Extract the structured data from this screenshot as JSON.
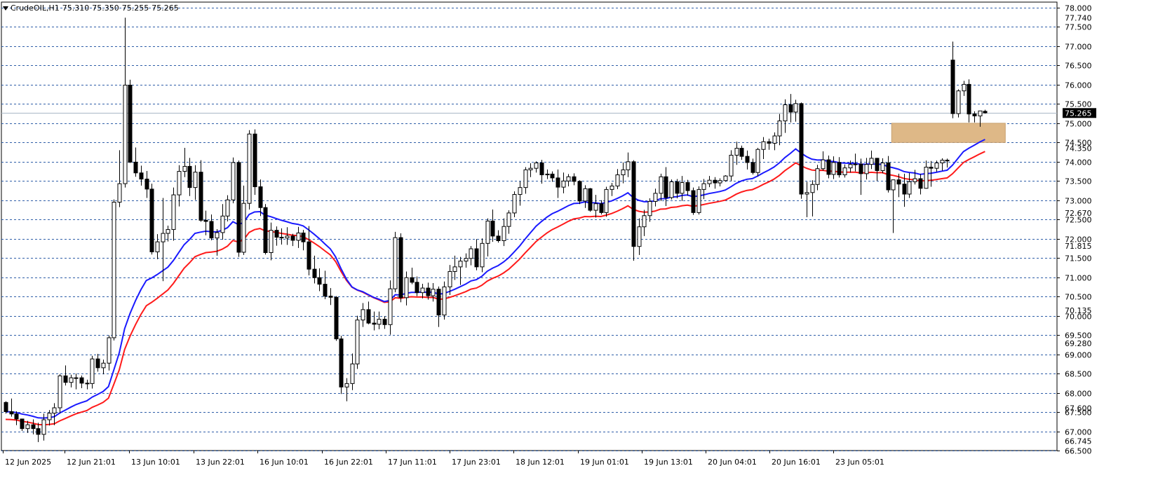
{
  "header": {
    "symbol_timeframe": "CrudeOIL,H1",
    "open": "75.310",
    "high": "75.350",
    "low": "75.255",
    "close": "75.265"
  },
  "colors": {
    "background": "#ffffff",
    "grid": "#2f5ea8",
    "bull_candle": "#ffffff",
    "bear_candle": "#000000",
    "ma_fast": "#1a1aff",
    "ma_slow": "#ff1a1a",
    "zone": "#deb887",
    "price_line": "#a9b7c6",
    "price_badge_bg": "#000000",
    "price_badge_fg": "#ffffff"
  },
  "chart_data": {
    "type": "candlestick",
    "symbol": "CrudeOIL",
    "timeframe": "H1",
    "y_range": [
      66.5,
      78.0
    ],
    "y_ticks": [
      "78.000",
      "77.500",
      "77.000",
      "76.500",
      "76.000",
      "75.500",
      "75.000",
      "74.500",
      "74.000",
      "73.500",
      "73.000",
      "72.500",
      "72.000",
      "71.500",
      "71.000",
      "70.500",
      "70.000",
      "69.500",
      "69.000",
      "68.500",
      "68.000",
      "67.500",
      "67.000",
      "66.500"
    ],
    "extra_price_labels": [
      "77.740",
      "74.350",
      "72.670",
      "71.815",
      "70.135",
      "69.280",
      "67.600",
      "66.745"
    ],
    "current_price": "75.265",
    "x_labels": [
      "12 Jun 2025",
      "12 Jun 21:01",
      "13 Jun 10:01",
      "13 Jun 22:01",
      "16 Jun 10:01",
      "16 Jun 22:01",
      "17 Jun 11:01",
      "17 Jun 23:01",
      "18 Jun 12:01",
      "19 Jun 01:01",
      "19 Jun 13:01",
      "20 Jun 04:01",
      "20 Jun 16:01",
      "23 Jun 05:01"
    ],
    "grid": "dashed horizontal",
    "zone": {
      "top": 75.0,
      "bottom": 74.5,
      "bars": [
        164,
        185
      ]
    },
    "ohlc": [
      [
        67.75,
        67.78,
        67.46,
        67.51
      ],
      [
        67.51,
        67.85,
        67.38,
        67.45
      ],
      [
        67.45,
        67.52,
        67.16,
        67.32
      ],
      [
        67.32,
        67.32,
        67.01,
        67.07
      ],
      [
        67.07,
        67.27,
        66.96,
        67.17
      ],
      [
        67.17,
        67.31,
        66.92,
        67.07
      ],
      [
        67.07,
        67.22,
        66.72,
        66.92
      ],
      [
        66.92,
        67.46,
        66.76,
        67.3
      ],
      [
        67.3,
        67.55,
        67.15,
        67.47
      ],
      [
        67.47,
        67.73,
        67.16,
        67.61
      ],
      [
        67.61,
        68.48,
        67.47,
        68.44
      ],
      [
        68.44,
        68.71,
        68.19,
        68.27
      ],
      [
        68.27,
        68.47,
        68.14,
        68.39
      ],
      [
        68.39,
        68.5,
        68.09,
        68.39
      ],
      [
        68.39,
        68.45,
        68.12,
        68.25
      ],
      [
        68.25,
        68.34,
        68.09,
        68.24
      ],
      [
        68.24,
        68.96,
        68.11,
        68.88
      ],
      [
        68.88,
        69.01,
        68.55,
        68.65
      ],
      [
        68.65,
        68.86,
        68.48,
        68.77
      ],
      [
        68.77,
        69.49,
        68.58,
        69.43
      ],
      [
        69.43,
        73.02,
        69.36,
        72.95
      ],
      [
        72.95,
        74.3,
        72.82,
        73.43
      ],
      [
        73.43,
        77.74,
        73.33,
        75.99
      ],
      [
        75.99,
        76.13,
        73.97,
        73.99
      ],
      [
        73.99,
        74.37,
        73.61,
        73.71
      ],
      [
        73.71,
        73.9,
        73.38,
        73.55
      ],
      [
        73.55,
        73.76,
        73.06,
        73.29
      ],
      [
        73.29,
        73.43,
        71.59,
        71.66
      ],
      [
        71.66,
        72.12,
        71.47,
        71.92
      ],
      [
        71.92,
        73.06,
        70.9,
        72.14
      ],
      [
        72.14,
        72.34,
        71.93,
        72.24
      ],
      [
        72.24,
        73.33,
        71.95,
        73.14
      ],
      [
        73.14,
        73.91,
        72.84,
        73.75
      ],
      [
        73.75,
        74.36,
        73.6,
        73.88
      ],
      [
        73.88,
        74.1,
        73.11,
        73.33
      ],
      [
        73.33,
        73.91,
        73.01,
        73.73
      ],
      [
        73.73,
        74.04,
        72.44,
        72.48
      ],
      [
        72.48,
        72.73,
        72.09,
        72.45
      ],
      [
        72.45,
        72.63,
        71.96,
        72.02
      ],
      [
        72.02,
        72.25,
        71.56,
        72.16
      ],
      [
        72.16,
        72.9,
        71.98,
        72.59
      ],
      [
        72.59,
        73.13,
        72.45,
        73.01
      ],
      [
        73.01,
        74.11,
        72.92,
        73.98
      ],
      [
        73.98,
        74.03,
        71.53,
        71.65
      ],
      [
        71.65,
        73.38,
        71.58,
        72.92
      ],
      [
        72.92,
        74.82,
        72.76,
        74.72
      ],
      [
        74.72,
        74.84,
        73.14,
        73.35
      ],
      [
        73.35,
        73.54,
        72.59,
        72.81
      ],
      [
        72.81,
        72.9,
        71.59,
        71.64
      ],
      [
        71.64,
        72.42,
        71.44,
        72.22
      ],
      [
        72.22,
        72.32,
        71.82,
        72.04
      ],
      [
        72.04,
        72.27,
        71.85,
        72.02
      ],
      [
        72.02,
        72.3,
        71.84,
        72.07
      ],
      [
        72.07,
        72.13,
        71.81,
        71.96
      ],
      [
        71.96,
        72.31,
        71.76,
        72.15
      ],
      [
        72.15,
        72.23,
        71.7,
        71.92
      ],
      [
        71.92,
        72.33,
        71.05,
        71.21
      ],
      [
        71.21,
        71.56,
        70.84,
        70.99
      ],
      [
        70.99,
        71.23,
        70.64,
        70.82
      ],
      [
        70.82,
        71.17,
        70.43,
        70.51
      ],
      [
        70.51,
        70.72,
        70.28,
        70.48
      ],
      [
        70.48,
        70.51,
        69.35,
        69.4
      ],
      [
        69.4,
        69.48,
        67.97,
        68.15
      ],
      [
        68.15,
        68.38,
        67.78,
        68.24
      ],
      [
        68.24,
        69.02,
        68.07,
        68.75
      ],
      [
        68.75,
        70.0,
        68.62,
        69.89
      ],
      [
        69.89,
        70.33,
        69.71,
        70.16
      ],
      [
        70.16,
        70.37,
        69.78,
        69.81
      ],
      [
        69.81,
        70.11,
        69.62,
        69.78
      ],
      [
        69.78,
        70.11,
        69.65,
        69.91
      ],
      [
        69.91,
        69.99,
        69.66,
        69.77
      ],
      [
        69.77,
        70.92,
        69.51,
        70.7
      ],
      [
        70.7,
        72.18,
        70.61,
        72.03
      ],
      [
        72.03,
        72.14,
        70.35,
        70.47
      ],
      [
        70.47,
        71.15,
        70.27,
        70.99
      ],
      [
        70.99,
        71.25,
        70.82,
        70.87
      ],
      [
        70.87,
        71.02,
        70.51,
        70.6
      ],
      [
        70.6,
        70.83,
        70.45,
        70.72
      ],
      [
        70.72,
        70.86,
        70.42,
        70.52
      ],
      [
        70.52,
        70.85,
        70.37,
        70.69
      ],
      [
        70.69,
        70.76,
        69.71,
        70.02
      ],
      [
        70.02,
        70.89,
        69.9,
        70.75
      ],
      [
        70.75,
        71.32,
        70.54,
        71.15
      ],
      [
        71.15,
        71.56,
        70.93,
        71.27
      ],
      [
        71.27,
        71.53,
        70.8,
        71.42
      ],
      [
        71.42,
        71.62,
        71.25,
        71.49
      ],
      [
        71.49,
        71.81,
        71.31,
        71.74
      ],
      [
        71.74,
        71.99,
        71.18,
        71.27
      ],
      [
        71.27,
        72.01,
        71.13,
        71.88
      ],
      [
        71.88,
        72.53,
        71.54,
        72.46
      ],
      [
        72.46,
        72.76,
        71.92,
        72.07
      ],
      [
        72.07,
        72.22,
        71.9,
        71.95
      ],
      [
        71.95,
        72.53,
        71.81,
        72.32
      ],
      [
        72.32,
        72.74,
        72.13,
        72.67
      ],
      [
        72.67,
        73.23,
        72.56,
        73.15
      ],
      [
        73.15,
        73.49,
        72.86,
        73.33
      ],
      [
        73.33,
        73.86,
        73.17,
        73.79
      ],
      [
        73.79,
        73.96,
        73.6,
        73.83
      ],
      [
        73.83,
        74.01,
        73.72,
        73.97
      ],
      [
        73.97,
        74.05,
        73.43,
        73.66
      ],
      [
        73.66,
        73.8,
        73.55,
        73.68
      ],
      [
        73.68,
        73.75,
        73.48,
        73.58
      ],
      [
        73.58,
        73.8,
        73.06,
        73.34
      ],
      [
        73.34,
        73.72,
        73.18,
        73.5
      ],
      [
        73.5,
        73.68,
        73.36,
        73.61
      ],
      [
        73.61,
        73.7,
        73.39,
        73.49
      ],
      [
        73.49,
        73.52,
        72.9,
        72.98
      ],
      [
        72.98,
        73.39,
        72.8,
        73.3
      ],
      [
        73.3,
        73.32,
        72.7,
        72.74
      ],
      [
        72.74,
        73.14,
        72.55,
        72.91
      ],
      [
        72.91,
        73.0,
        72.63,
        72.68
      ],
      [
        72.68,
        73.35,
        72.57,
        73.28
      ],
      [
        73.28,
        73.45,
        73.11,
        73.37
      ],
      [
        73.37,
        73.81,
        73.29,
        73.66
      ],
      [
        73.66,
        73.98,
        73.44,
        73.79
      ],
      [
        73.79,
        74.24,
        73.6,
        74.0
      ],
      [
        74.0,
        74.04,
        71.43,
        71.8
      ],
      [
        71.8,
        72.53,
        71.58,
        72.31
      ],
      [
        72.31,
        72.75,
        72.07,
        72.6
      ],
      [
        72.6,
        73.05,
        72.44,
        72.97
      ],
      [
        72.97,
        73.3,
        72.84,
        73.18
      ],
      [
        73.18,
        73.69,
        72.98,
        73.61
      ],
      [
        73.61,
        73.86,
        72.85,
        73.07
      ],
      [
        73.07,
        73.54,
        73.02,
        73.48
      ],
      [
        73.48,
        73.55,
        73.05,
        73.18
      ],
      [
        73.18,
        73.63,
        72.98,
        73.46
      ],
      [
        73.46,
        73.53,
        73.12,
        73.25
      ],
      [
        73.25,
        73.33,
        72.62,
        72.68
      ],
      [
        72.68,
        73.36,
        72.63,
        73.28
      ],
      [
        73.28,
        73.55,
        73.03,
        73.43
      ],
      [
        73.43,
        73.63,
        73.34,
        73.52
      ],
      [
        73.52,
        73.6,
        73.3,
        73.45
      ],
      [
        73.45,
        73.57,
        73.36,
        73.51
      ],
      [
        73.51,
        73.65,
        73.48,
        73.63
      ],
      [
        73.63,
        74.3,
        73.5,
        74.17
      ],
      [
        74.17,
        74.52,
        73.92,
        74.35
      ],
      [
        74.35,
        74.42,
        74.05,
        74.14
      ],
      [
        74.14,
        74.29,
        73.8,
        73.98
      ],
      [
        73.98,
        74.08,
        73.67,
        73.72
      ],
      [
        73.72,
        74.36,
        73.62,
        74.32
      ],
      [
        74.32,
        74.64,
        74.07,
        74.52
      ],
      [
        74.52,
        74.6,
        74.31,
        74.48
      ],
      [
        74.48,
        74.76,
        74.3,
        74.67
      ],
      [
        74.67,
        75.24,
        74.43,
        75.06
      ],
      [
        75.06,
        75.62,
        74.75,
        75.48
      ],
      [
        75.48,
        75.76,
        75.02,
        75.29
      ],
      [
        75.29,
        75.61,
        75.04,
        75.51
      ],
      [
        75.51,
        75.54,
        73.04,
        73.16
      ],
      [
        73.16,
        73.48,
        72.56,
        73.2
      ],
      [
        73.2,
        73.52,
        72.58,
        73.41
      ],
      [
        73.41,
        73.92,
        73.26,
        73.82
      ],
      [
        73.82,
        74.27,
        73.77,
        74.05
      ],
      [
        74.05,
        74.16,
        73.57,
        73.67
      ],
      [
        73.67,
        74.14,
        73.55,
        73.98
      ],
      [
        73.98,
        74.12,
        73.59,
        73.66
      ],
      [
        73.66,
        73.93,
        73.59,
        73.84
      ],
      [
        73.84,
        74.03,
        73.72,
        73.93
      ],
      [
        73.93,
        74.21,
        73.75,
        73.94
      ],
      [
        73.94,
        74.08,
        73.14,
        73.69
      ],
      [
        73.69,
        74.1,
        73.54,
        73.93
      ],
      [
        73.93,
        74.29,
        73.81,
        74.09
      ],
      [
        74.09,
        74.1,
        73.5,
        73.77
      ],
      [
        73.77,
        74.09,
        73.7,
        73.97
      ],
      [
        73.97,
        74.15,
        73.2,
        73.27
      ],
      [
        73.27,
        73.52,
        72.15,
        73.53
      ],
      [
        73.53,
        73.69,
        73.08,
        73.42
      ],
      [
        73.42,
        73.69,
        72.83,
        73.16
      ],
      [
        73.16,
        73.71,
        73.06,
        73.48
      ],
      [
        73.48,
        73.79,
        73.41,
        73.56
      ],
      [
        73.56,
        73.68,
        73.15,
        73.31
      ],
      [
        73.31,
        74.03,
        73.3,
        73.86
      ],
      [
        73.86,
        74.02,
        73.35,
        73.83
      ],
      [
        73.83,
        74.03,
        73.74,
        73.97
      ],
      [
        73.97,
        74.09,
        73.77,
        74.04
      ],
      [
        74.04,
        74.08,
        73.85,
        74.03
      ],
      [
        76.64,
        77.12,
        75.13,
        75.25
      ],
      [
        75.25,
        75.88,
        75.15,
        75.84
      ],
      [
        75.84,
        76.1,
        75.71,
        76.01
      ],
      [
        76.01,
        76.14,
        75.02,
        75.24
      ],
      [
        75.24,
        75.31,
        75.02,
        75.19
      ],
      [
        75.19,
        75.31,
        74.91,
        75.32
      ],
      [
        75.31,
        75.35,
        75.25,
        75.27
      ]
    ]
  }
}
